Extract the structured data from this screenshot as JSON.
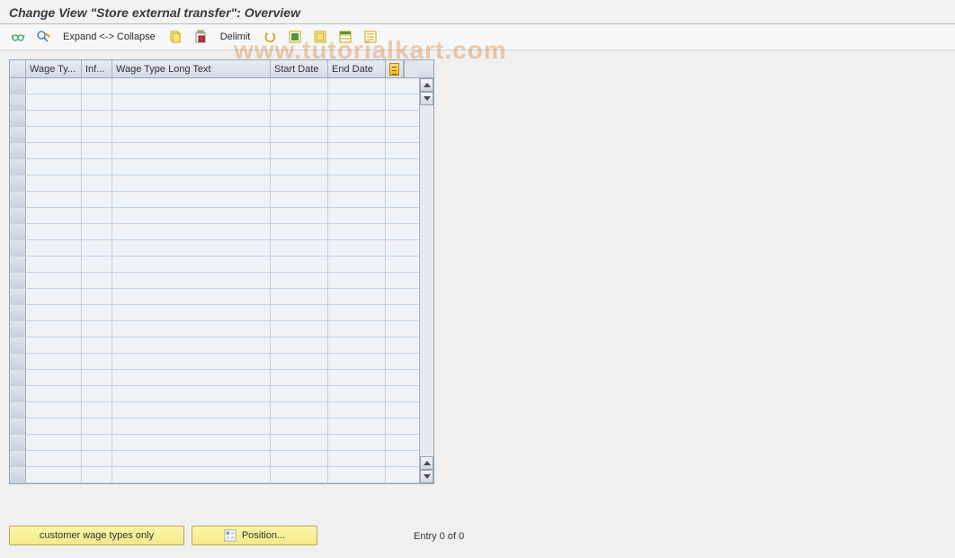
{
  "title": "Change View \"Store external transfer\": Overview",
  "toolbar": {
    "expand_label": "Expand <-> Collapse",
    "delimit_label": "Delimit"
  },
  "table": {
    "columns": {
      "wage_type": "Wage Ty...",
      "info": "Inf...",
      "wage_long": "Wage Type Long Text",
      "start_date": "Start Date",
      "end_date": "End Date"
    },
    "rows": []
  },
  "footer": {
    "customer_btn": "customer wage types only",
    "position_btn": "Position...",
    "entry_text": "Entry 0 of 0"
  },
  "watermark": "www.tutorialkart.com"
}
